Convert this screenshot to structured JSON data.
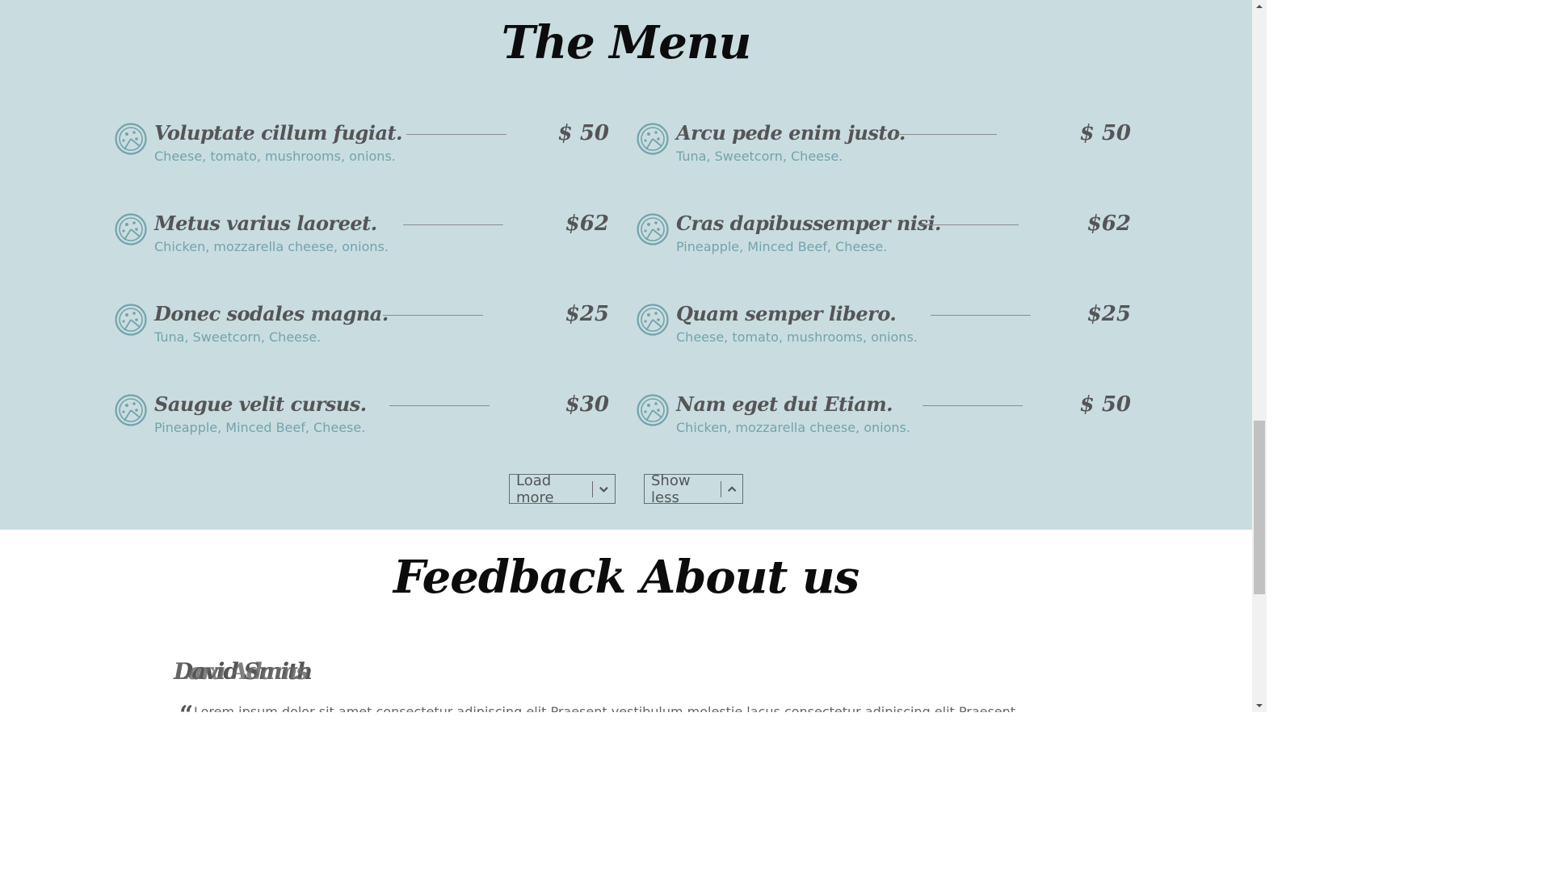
{
  "menu": {
    "title": "The Menu",
    "items_left": [
      {
        "name": "Voluptate cillum fugiat.",
        "description": "Cheese, tomato, mushrooms, onions.",
        "price": "$ 50"
      },
      {
        "name": "Metus varius laoreet.",
        "description": "Chicken, mozzarella cheese, onions.",
        "price": "$62"
      },
      {
        "name": "Donec sodales magna.",
        "description": "Tuna, Sweetcorn, Cheese.",
        "price": "$25"
      },
      {
        "name": "Saugue velit cursus.",
        "description": "Pineapple, Minced Beef, Cheese.",
        "price": "$30"
      }
    ],
    "items_right": [
      {
        "name": "Arcu pede enim justo.",
        "description": "Tuna, Sweetcorn, Cheese.",
        "price": "$ 50"
      },
      {
        "name": "Cras dapibussemper nisi.",
        "description": "Pineapple, Minced Beef, Cheese.",
        "price": "$62"
      },
      {
        "name": "Quam semper libero.",
        "description": "Cheese, tomato, mushrooms, onions.",
        "price": "$25"
      },
      {
        "name": "Nam eget dui Etiam.",
        "description": "Chicken, mozzarella cheese, onions.",
        "price": "$ 50"
      }
    ],
    "load_more_label": "Load more",
    "show_less_label": "Show less",
    "icon": "pizza-icon",
    "background": "#c9dde1",
    "accent": "#72a3ac"
  },
  "feedback": {
    "title": "Feedback About us",
    "reviewers": [
      "David Smith",
      "Lara Adams"
    ],
    "quote_mark": "“",
    "review_text": "Lorem ipsum dolor sit amet consectetur adipiscing elit Praesent vestibulum molestie lacus consectetur adipiscing elit Praesent"
  },
  "scrollbar": {
    "up_icon": "scroll-up-arrow-icon",
    "down_icon": "scroll-down-arrow-icon"
  }
}
